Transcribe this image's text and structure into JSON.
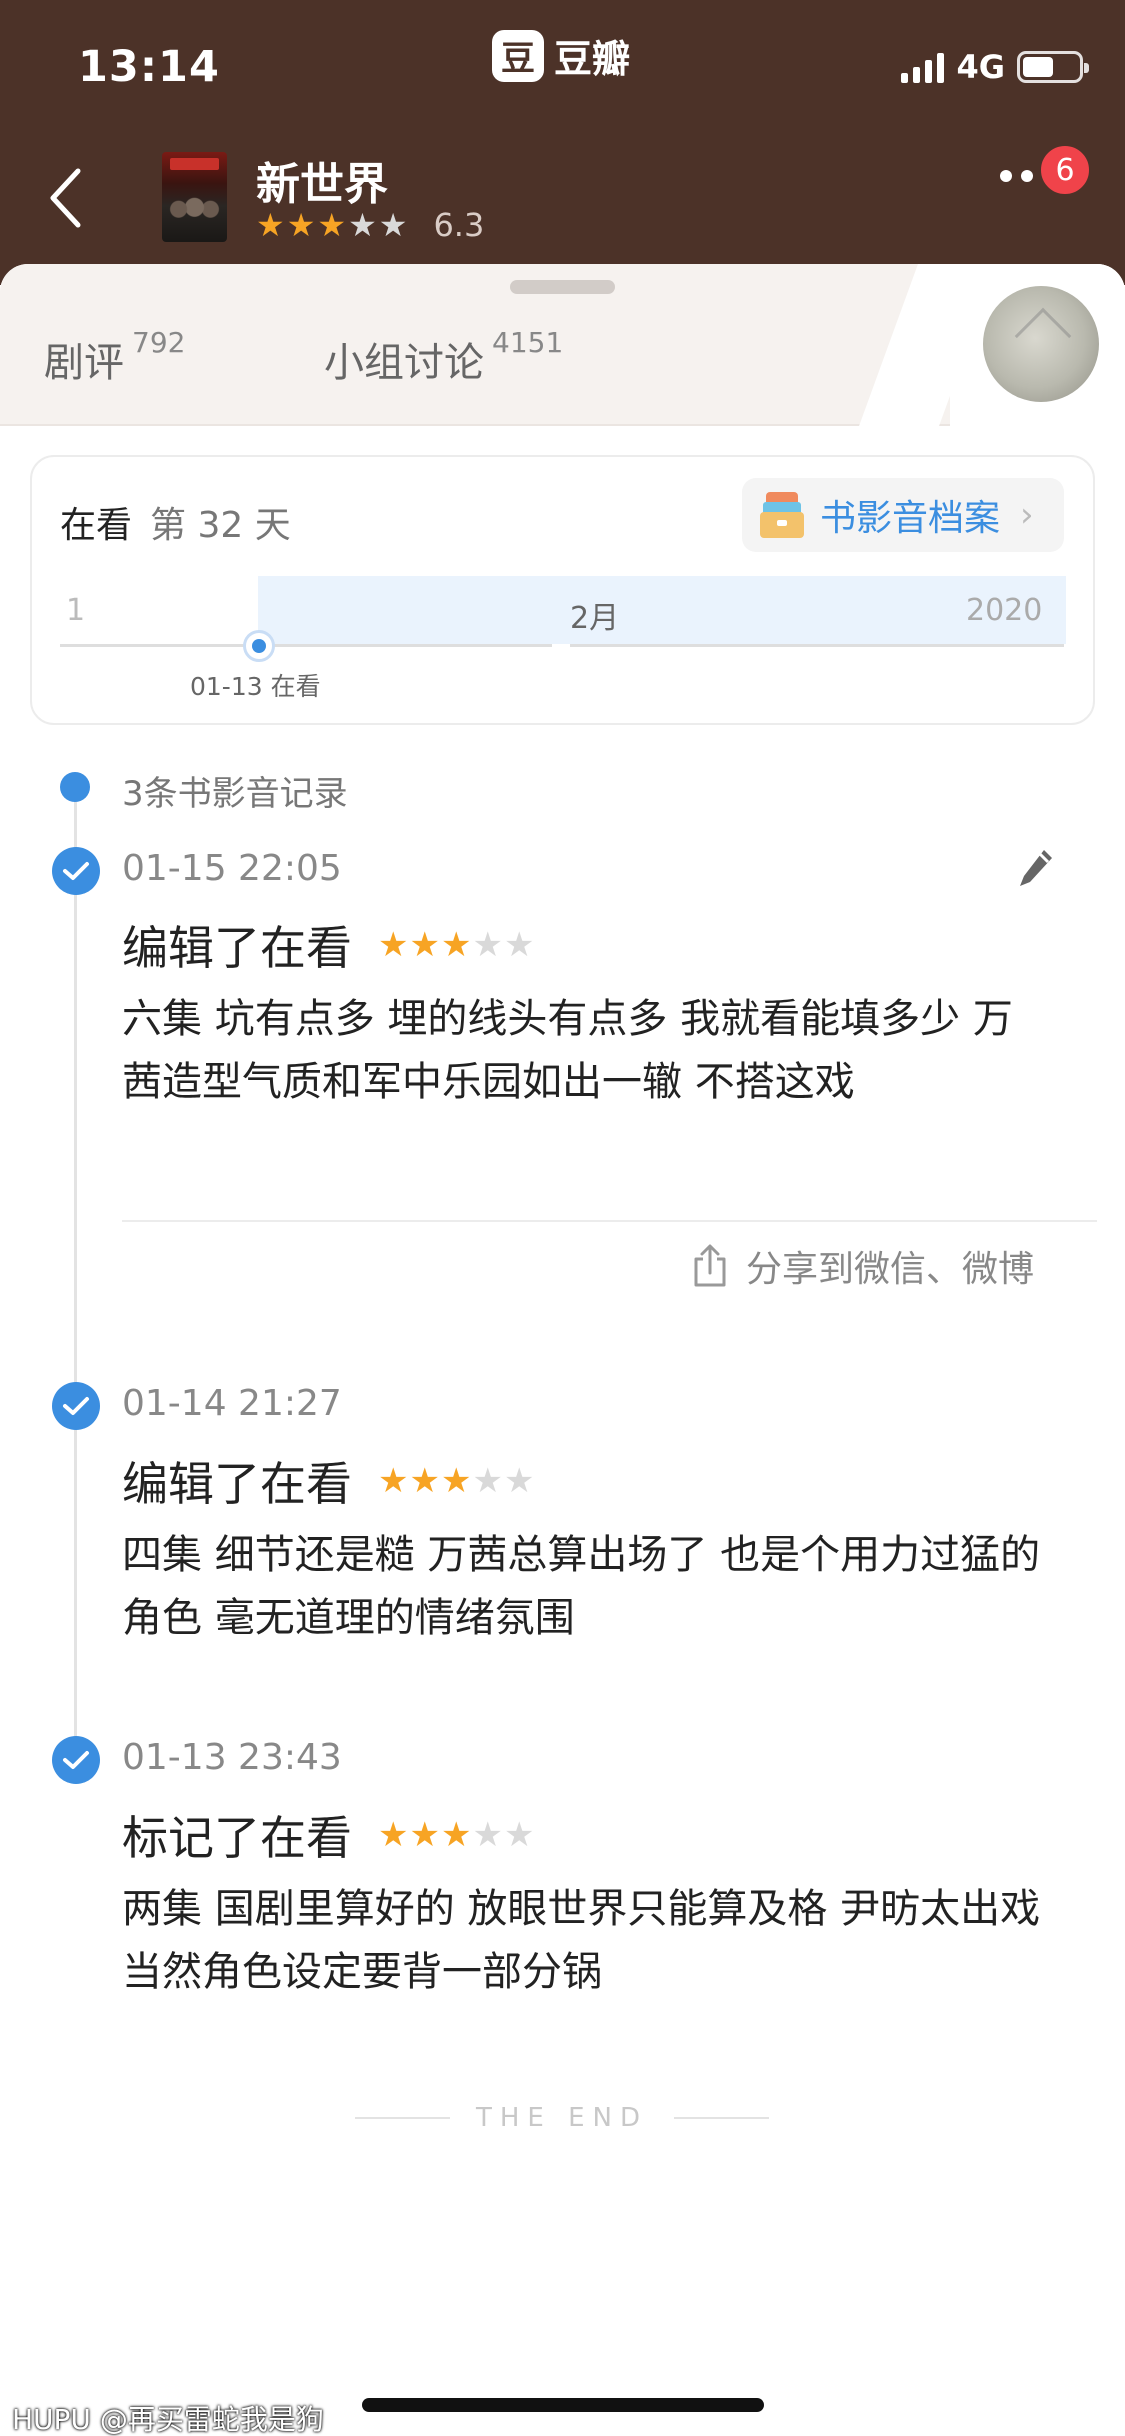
{
  "status_bar": {
    "time": "13:14",
    "network": "4G",
    "app_logo_glyph": "豆",
    "app_name": "豆瓣"
  },
  "header": {
    "title": "新世界",
    "rating_stars": 3,
    "score": "6.3",
    "notification_count": "6"
  },
  "tabs": [
    {
      "label": "剧评",
      "count": "792"
    },
    {
      "label": "小组讨论",
      "count": "4151"
    }
  ],
  "progress": {
    "status": "在看",
    "day": "第 32 天",
    "archive_label": "书影音档案",
    "archive_chevron": "›",
    "timeline": {
      "month_1": "1",
      "month_2": "2月",
      "year": "2020",
      "marker_label": "01-13 在看"
    }
  },
  "records": {
    "count_label": "3条书影音记录",
    "entries": [
      {
        "time": "01-15 22:05",
        "action": "编辑了在看",
        "stars": 3,
        "comment": "六集 坑有点多 埋的线头有点多 我就看能填多少 万茜造型气质和军中乐园如出一辙 不搭这戏"
      },
      {
        "time": "01-14 21:27",
        "action": "编辑了在看",
        "stars": 3,
        "comment": "四集 细节还是糙 万茜总算出场了 也是个用力过猛的角色 毫无道理的情绪氛围"
      },
      {
        "time": "01-13 23:43",
        "action": "标记了在看",
        "stars": 3,
        "comment": "两集 国剧里算好的 放眼世界只能算及格 尹昉太出戏 当然角色设定要背一部分锅"
      }
    ],
    "share_label": "分享到微信、微博"
  },
  "footer": {
    "end_text": "THE END",
    "watermark": "HUPU @再买雷蛇我是狗"
  },
  "colors": {
    "header_bg": "#4c3228",
    "accent_blue": "#3b8ee0",
    "star_gold": "#f7a424",
    "star_gray": "#d9d9d9",
    "badge_red": "#f0434a"
  },
  "icons": [
    "back-chevron-icon",
    "more-dots-icon",
    "archive-icon",
    "check-icon",
    "pencil-icon",
    "share-icon"
  ]
}
